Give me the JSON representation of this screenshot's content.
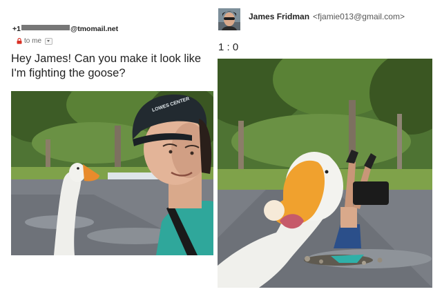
{
  "left_message": {
    "sender_prefix": "+1",
    "sender_suffix": "@tmomail.net",
    "recipient_label": "to me",
    "body": "Hey James! Can you make it look like I'm fighting the goose?"
  },
  "right_message": {
    "sender_name": "James Fridman",
    "sender_email": "<fjamie013@gmail.com>",
    "score": "1 : 0"
  },
  "images": {
    "left_photo": {
      "cap_text": "LOWES CENTER"
    }
  },
  "colors": {
    "accent_lock": "#d93025",
    "text_primary": "#222222",
    "text_secondary": "#666666"
  },
  "icons": [
    "lock-icon",
    "dropdown-arrow-icon"
  ]
}
